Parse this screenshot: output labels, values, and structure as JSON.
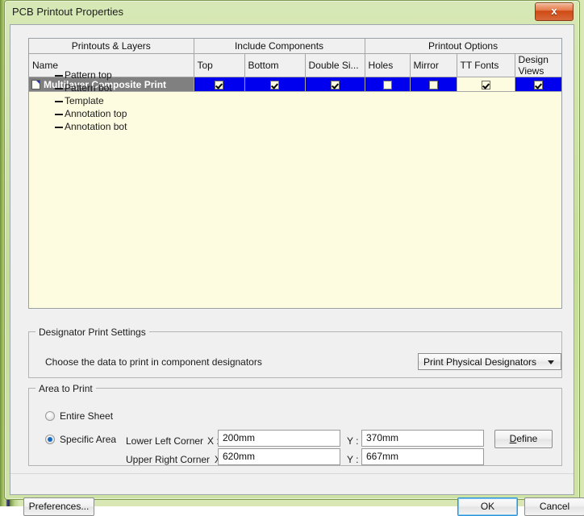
{
  "window": {
    "title": "PCB Printout Properties",
    "close_label": "x"
  },
  "grid": {
    "group_headers": [
      {
        "label": "Printouts & Layers",
        "span": 1
      },
      {
        "label": "Include Components",
        "span": 3
      },
      {
        "label": "Printout Options",
        "span": 4
      }
    ],
    "columns": [
      "Name",
      "Top",
      "Bottom",
      "Double Si...",
      "Holes",
      "Mirror",
      "TT Fonts",
      "Design Views"
    ],
    "rows": [
      {
        "name": "Multilayer Composite Print",
        "selected": true,
        "icon": "page-icon",
        "values": {
          "Top": true,
          "Bottom": true,
          "Double Si...": false,
          "Holes": false,
          "Mirror": false,
          "TT Fonts": true,
          "Design Views": true
        },
        "double_sided_checked": true,
        "focused_column": "TT Fonts"
      }
    ],
    "layers": [
      "Pattern top",
      "Pattern bot",
      "Template",
      "Annotation top",
      "Annotation bot"
    ]
  },
  "designator": {
    "group_title": "Designator Print Settings",
    "prompt": "Choose the data to print in component designators",
    "combo_value": "Print Physical Designators"
  },
  "area": {
    "group_title": "Area to Print",
    "entire_sheet_label": "Entire Sheet",
    "specific_area_label": "Specific Area",
    "entire_sheet_selected": false,
    "specific_area_selected": true,
    "lower_left_label": "Lower Left Corner",
    "upper_right_label": "Upper Right Corner",
    "x_label": "X :",
    "y_label": "Y :",
    "lower_left_x": "200mm",
    "lower_left_y": "370mm",
    "upper_right_x": "620mm",
    "upper_right_y": "667mm",
    "define_label_prefix": "",
    "define_accel": "D",
    "define_label_rest": "efine"
  },
  "footer": {
    "preferences_label": "Preferences...",
    "ok_label": "OK",
    "cancel_label": "Cancel"
  },
  "colors": {
    "selected_row_bg": "#808080",
    "checkbox_cell_bg": "#0000ee",
    "grid_bg": "#fdfce1",
    "window_frame": "#c5de96"
  }
}
